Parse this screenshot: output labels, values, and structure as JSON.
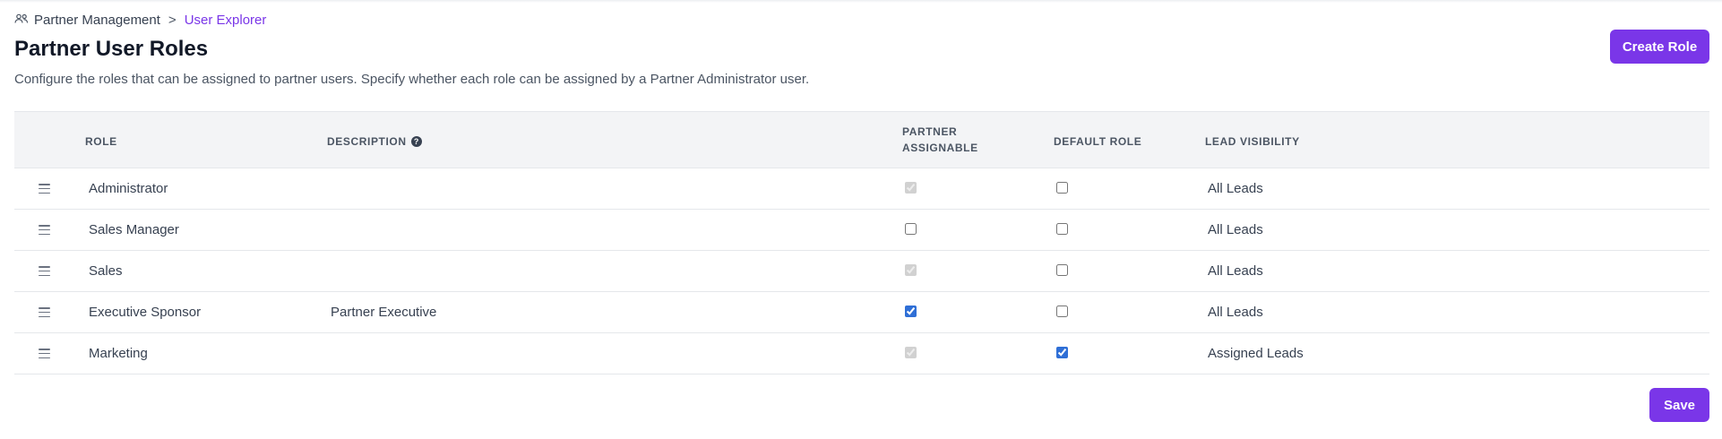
{
  "breadcrumb": {
    "parent": "Partner Management",
    "separator": ">",
    "current": "User Explorer"
  },
  "page": {
    "title": "Partner User Roles",
    "subtitle": "Configure the roles that can be assigned to partner users. Specify whether each role can be assigned by a Partner Administrator user.",
    "create_label": "Create Role",
    "save_label": "Save"
  },
  "table": {
    "headers": {
      "role": "ROLE",
      "description": "DESCRIPTION",
      "partner_assignable_line1": "PARTNER",
      "partner_assignable_line2": "ASSIGNABLE",
      "default_role": "DEFAULT ROLE",
      "lead_visibility": "LEAD VISIBILITY"
    },
    "rows": [
      {
        "role": "Administrator",
        "description": "",
        "partner_assignable": true,
        "partner_assignable_disabled": true,
        "default_role": false,
        "lead_visibility": "All Leads"
      },
      {
        "role": "Sales Manager",
        "description": "",
        "partner_assignable": false,
        "partner_assignable_disabled": false,
        "default_role": false,
        "lead_visibility": "All Leads"
      },
      {
        "role": "Sales",
        "description": "",
        "partner_assignable": true,
        "partner_assignable_disabled": true,
        "default_role": false,
        "lead_visibility": "All Leads"
      },
      {
        "role": "Executive Sponsor",
        "description": "Partner Executive",
        "partner_assignable": true,
        "partner_assignable_disabled": false,
        "default_role": false,
        "lead_visibility": "All Leads"
      },
      {
        "role": "Marketing",
        "description": "",
        "partner_assignable": true,
        "partner_assignable_disabled": true,
        "default_role": true,
        "lead_visibility": "Assigned Leads"
      }
    ]
  },
  "icons": {
    "breadcrumb": "users-icon",
    "help": "question-circle-icon",
    "drag": "drag-handle-icon"
  },
  "colors": {
    "accent": "#7a36e8",
    "checkbox": "#2f6fd6"
  }
}
